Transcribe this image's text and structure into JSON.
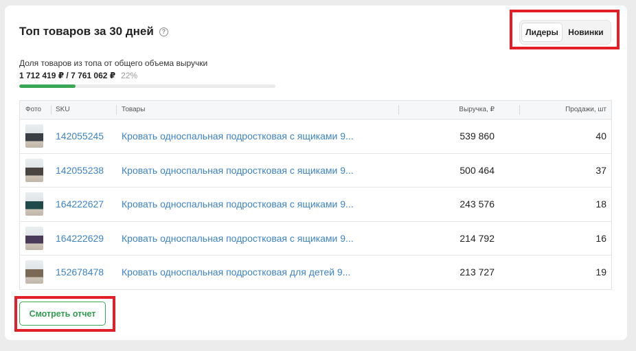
{
  "widget": {
    "title": "Топ товаров за 30 дней",
    "help_icon": "question-circle-icon",
    "toggle": {
      "active": "Лидеры",
      "inactive": "Новинки"
    },
    "share": {
      "label": "Доля товаров из топа от общего объема выручки",
      "values": "1 712 419 ₽ / 7 761 062 ₽",
      "percent": "22%",
      "progress_fraction": 0.22
    },
    "table": {
      "headers": {
        "photo": "Фото",
        "sku": "SKU",
        "name": "Товары",
        "revenue": "Выручка, ₽",
        "sales": "Продажи, шт"
      },
      "rows": [
        {
          "sku": "142055245",
          "name": "Кровать односпальная подростковая с ящиками 9...",
          "revenue": "539 860",
          "sales": "40",
          "thumb_color": "#3a3f45"
        },
        {
          "sku": "142055238",
          "name": "Кровать односпальная подростковая с ящиками 9...",
          "revenue": "500 464",
          "sales": "37",
          "thumb_color": "#4a4540"
        },
        {
          "sku": "164222627",
          "name": "Кровать односпальная подростковая с ящиками 9...",
          "revenue": "243 576",
          "sales": "18",
          "thumb_color": "#1e4a4a"
        },
        {
          "sku": "164222629",
          "name": "Кровать односпальная подростковая с ящиками 9...",
          "revenue": "214 792",
          "sales": "16",
          "thumb_color": "#4a3a5a"
        },
        {
          "sku": "152678478",
          "name": "Кровать односпальная подростковая для детей 9...",
          "revenue": "213 727",
          "sales": "19",
          "thumb_color": "#7a6a55"
        }
      ]
    },
    "report_button": "Смотреть отчет"
  },
  "colors": {
    "accent_green": "#3aa757",
    "link_blue": "#3d84c6",
    "highlight_red": "#e01f26"
  }
}
